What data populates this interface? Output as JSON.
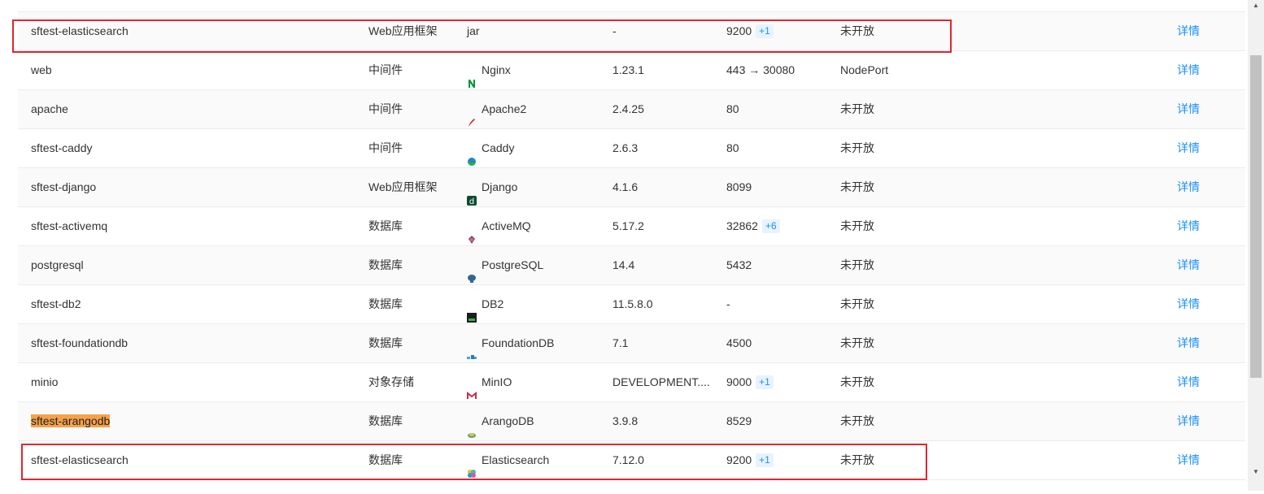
{
  "rows": [
    {
      "name": "sftest-elasticsearch",
      "type": "Web应用框架",
      "component": "jar",
      "icon": "none",
      "version": "-",
      "port": "9200",
      "port_extra": "+1",
      "expose": "未开放",
      "action": "详情",
      "highlight": false
    },
    {
      "name": "web",
      "type": "中间件",
      "component": "Nginx",
      "icon": "nginx-icon",
      "version": "1.23.1",
      "port": "443 → 30080",
      "port_extra": "",
      "expose": "NodePort",
      "action": "详情",
      "highlight": false
    },
    {
      "name": "apache",
      "type": "中间件",
      "component": "Apache2",
      "icon": "apache-feather-icon",
      "version": "2.4.25",
      "port": "80",
      "port_extra": "",
      "expose": "未开放",
      "action": "详情",
      "highlight": false
    },
    {
      "name": "sftest-caddy",
      "type": "中间件",
      "component": "Caddy",
      "icon": "caddy-icon",
      "version": "2.6.3",
      "port": "80",
      "port_extra": "",
      "expose": "未开放",
      "action": "详情",
      "highlight": false
    },
    {
      "name": "sftest-django",
      "type": "Web应用框架",
      "component": "Django",
      "icon": "django-icon",
      "version": "4.1.6",
      "port": "8099",
      "port_extra": "",
      "expose": "未开放",
      "action": "详情",
      "highlight": false
    },
    {
      "name": "sftest-activemq",
      "type": "数据库",
      "component": "ActiveMQ",
      "icon": "activemq-icon",
      "version": "5.17.2",
      "port": "32862",
      "port_extra": "+6",
      "expose": "未开放",
      "action": "详情",
      "highlight": false
    },
    {
      "name": "postgresql",
      "type": "数据库",
      "component": "PostgreSQL",
      "icon": "postgresql-icon",
      "version": "14.4",
      "port": "5432",
      "port_extra": "",
      "expose": "未开放",
      "action": "详情",
      "highlight": false
    },
    {
      "name": "sftest-db2",
      "type": "数据库",
      "component": "DB2",
      "icon": "db2-icon",
      "version": "11.5.8.0",
      "port": "-",
      "port_extra": "",
      "expose": "未开放",
      "action": "详情",
      "highlight": false
    },
    {
      "name": "sftest-foundationdb",
      "type": "数据库",
      "component": "FoundationDB",
      "icon": "foundationdb-icon",
      "version": "7.1",
      "port": "4500",
      "port_extra": "",
      "expose": "未开放",
      "action": "详情",
      "highlight": false
    },
    {
      "name": "minio",
      "type": "对象存储",
      "component": "MinIO",
      "icon": "minio-icon",
      "version": "DEVELOPMENT....",
      "port": "9000",
      "port_extra": "+1",
      "expose": "未开放",
      "action": "详情",
      "highlight": false
    },
    {
      "name": "sftest-arangodb",
      "type": "数据库",
      "component": "ArangoDB",
      "icon": "arangodb-icon",
      "version": "3.9.8",
      "port": "8529",
      "port_extra": "",
      "expose": "未开放",
      "action": "详情",
      "highlight": true
    },
    {
      "name": "sftest-elasticsearch",
      "type": "数据库",
      "component": "Elasticsearch",
      "icon": "elasticsearch-icon",
      "version": "7.12.0",
      "port": "9200",
      "port_extra": "+1",
      "expose": "未开放",
      "action": "详情",
      "highlight": false
    }
  ],
  "colors": {
    "link": "#1890ff",
    "badge_bg": "#e8f3ff",
    "highlight": "#f5a24a",
    "annotation": "#e0262e"
  }
}
